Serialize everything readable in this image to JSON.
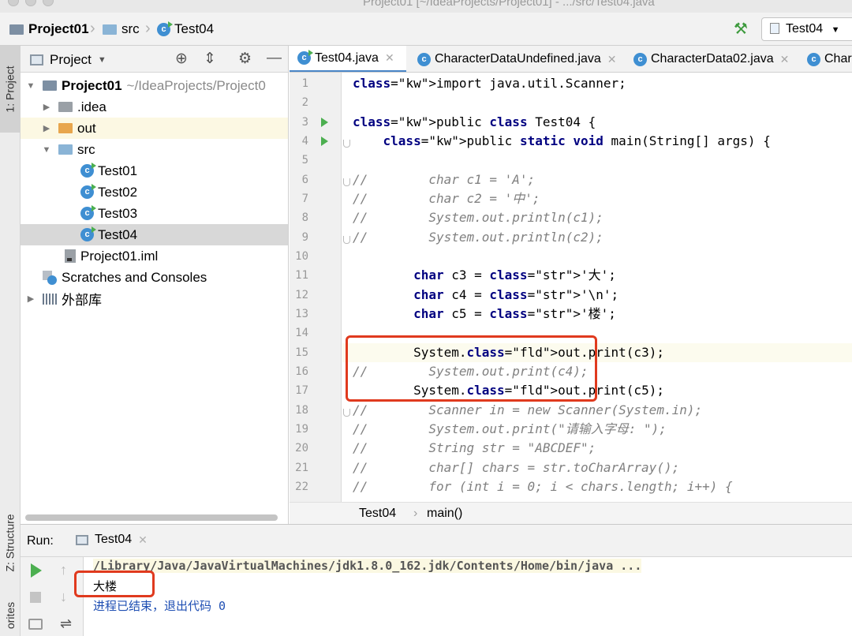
{
  "window": {
    "title": "Project01 [~/IdeaProjects/Project01] - .../src/Test04.java"
  },
  "navbar": {
    "project": "Project01",
    "src": "src",
    "file": "Test04",
    "run_config": "Test04"
  },
  "left_strip": {
    "project_tab": "1: Project",
    "structure_tab": "Z: Structure",
    "favorites_tab": "orites"
  },
  "project_panel": {
    "title": "Project",
    "tree": [
      {
        "label": "Project01",
        "hint": "~/IdeaProjects/Project0"
      },
      {
        "label": ".idea"
      },
      {
        "label": "out"
      },
      {
        "label": "src"
      },
      {
        "label": "Test01"
      },
      {
        "label": "Test02"
      },
      {
        "label": "Test03"
      },
      {
        "label": "Test04"
      },
      {
        "label": "Project01.iml"
      },
      {
        "label": "Scratches and Consoles"
      },
      {
        "label": "外部库"
      }
    ]
  },
  "editor": {
    "tabs": [
      {
        "label": "Test04.java"
      },
      {
        "label": "CharacterDataUndefined.java"
      },
      {
        "label": "CharacterData02.java"
      },
      {
        "label": "Char"
      }
    ],
    "code_lines": [
      {
        "n": "1",
        "text": "import java.util.Scanner;"
      },
      {
        "n": "2",
        "text": ""
      },
      {
        "n": "3",
        "text": "public class Test04 {"
      },
      {
        "n": "4",
        "text": "    public static void main(String[] args) {"
      },
      {
        "n": "5",
        "text": ""
      },
      {
        "n": "6",
        "text": "//        char c1 = 'A';"
      },
      {
        "n": "7",
        "text": "//        char c2 = '中';"
      },
      {
        "n": "8",
        "text": "//        System.out.println(c1);"
      },
      {
        "n": "9",
        "text": "//        System.out.println(c2);"
      },
      {
        "n": "10",
        "text": ""
      },
      {
        "n": "11",
        "text": "        char c3 = '大';"
      },
      {
        "n": "12",
        "text": "        char c4 = '\\n';"
      },
      {
        "n": "13",
        "text": "        char c5 = '楼';"
      },
      {
        "n": "14",
        "text": ""
      },
      {
        "n": "15",
        "text": "        System.out.print(c3);"
      },
      {
        "n": "16",
        "text": "//        System.out.print(c4);"
      },
      {
        "n": "17",
        "text": "        System.out.print(c5);"
      },
      {
        "n": "18",
        "text": "//        Scanner in = new Scanner(System.in);"
      },
      {
        "n": "19",
        "text": "//        System.out.print(\"请输入字母: \");"
      },
      {
        "n": "20",
        "text": "//        String str = \"ABCDEF\";"
      },
      {
        "n": "21",
        "text": "//        char[] chars = str.toCharArray();"
      },
      {
        "n": "22",
        "text": "//        for (int i = 0; i < chars.length; i++) {"
      }
    ],
    "breadcrumb": [
      "Test04",
      "main()"
    ]
  },
  "run_panel": {
    "label": "Run:",
    "tab": "Test04",
    "lines": [
      "/Library/Java/JavaVirtualMachines/jdk1.8.0_162.jdk/Contents/Home/bin/java ...",
      "大楼",
      "进程已结束，退出代码 0"
    ]
  }
}
